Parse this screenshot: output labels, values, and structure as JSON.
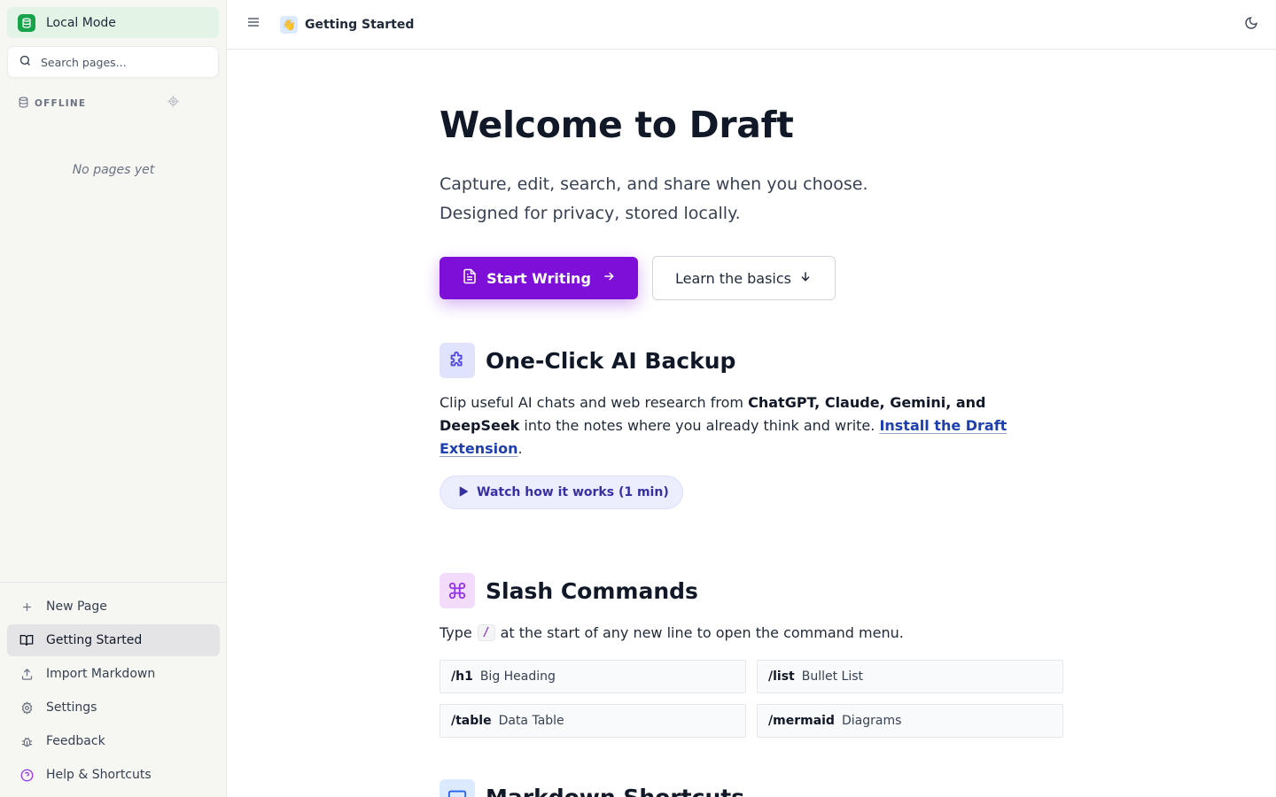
{
  "sidebar": {
    "mode_label": "Local Mode",
    "search_placeholder": "Search pages...",
    "section_label": "OFFLINE",
    "empty_text": "No pages yet",
    "items": [
      {
        "label": "New Page",
        "icon": "plus-icon"
      },
      {
        "label": "Getting Started",
        "icon": "book-open-icon",
        "active": true
      },
      {
        "label": "Import Markdown",
        "icon": "upload-icon"
      },
      {
        "label": "Settings",
        "icon": "gear-icon"
      },
      {
        "label": "Feedback",
        "icon": "bug-icon"
      },
      {
        "label": "Help & Shortcuts",
        "icon": "help-circle-icon"
      }
    ]
  },
  "header": {
    "page_emoji": "👋",
    "page_title": "Getting Started"
  },
  "hero": {
    "title": "Welcome to Draft",
    "subtitle_line1": "Capture, edit, search, and share when you choose.",
    "subtitle_line2": "Designed for privacy, stored locally.",
    "primary_button": "Start Writing",
    "secondary_button": "Learn the basics"
  },
  "backup": {
    "title": "One-Click AI Backup",
    "text_before": "Clip useful AI chats and web research from ",
    "text_bold": "ChatGPT, Claude, Gemini, and DeepSeek",
    "text_after": " into the notes where you already think and write. ",
    "link_text": "Install the Draft Extension",
    "text_end": ".",
    "watch_button": "Watch how it works (1 min)"
  },
  "slash": {
    "title": "Slash Commands",
    "type_before": "Type",
    "type_key": "/",
    "type_after": "at the start of any new line to open the command menu.",
    "commands": [
      {
        "code": "/h1",
        "desc": "Big Heading"
      },
      {
        "code": "/list",
        "desc": "Bullet List"
      },
      {
        "code": "/table",
        "desc": "Data Table"
      },
      {
        "code": "/mermaid",
        "desc": "Diagrams"
      }
    ]
  },
  "markdown": {
    "title": "Markdown Shortcuts"
  },
  "colors": {
    "accent": "#7e0fd8",
    "mode_green": "#16a34a",
    "link_blue": "#1e40af"
  }
}
